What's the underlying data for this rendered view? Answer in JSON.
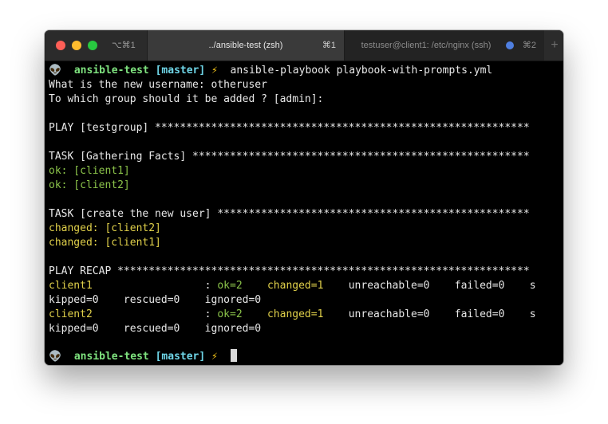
{
  "window": {
    "shortcut_left": "⌥⌘1",
    "tabs": [
      {
        "title": "../ansible-test (zsh)",
        "shortcut": "⌘1"
      },
      {
        "title": "testuser@client1: /etc/nginx (ssh)",
        "shortcut": "⌘2"
      }
    ],
    "new_tab_symbol": "+"
  },
  "terminal": {
    "prompt_icon": "👽",
    "prompt_dir": "ansible-test",
    "prompt_branch": "[master]",
    "prompt_bolt": "⚡",
    "command": "ansible-playbook playbook-with-prompts.yml",
    "q1_label": "What is the new username:",
    "q1_answer": "otheruser",
    "q2_label": "To which group should it be added ? [admin]:",
    "play_header": "PLAY [testgroup] ************************************************************",
    "task1_header": "TASK [Gathering Facts] ******************************************************",
    "task1_results": [
      "ok: [client1]",
      "ok: [client2]"
    ],
    "task2_header": "TASK [create the new user] **************************************************",
    "task2_results": [
      "changed: [client2]",
      "changed: [client1]"
    ],
    "recap_header": "PLAY RECAP ******************************************************************",
    "recap": [
      {
        "host": "client1",
        "sep": "                  : ",
        "ok": "ok=2",
        "gap1": "    ",
        "changed": "changed=1",
        "rest": "    unreachable=0    failed=0    s",
        "line2": "kipped=0    rescued=0    ignored=0"
      },
      {
        "host": "client2",
        "sep": "                  : ",
        "ok": "ok=2",
        "gap1": "    ",
        "changed": "changed=1",
        "rest": "    unreachable=0    failed=0    s",
        "line2": "kipped=0    rescued=0    ignored=0"
      }
    ]
  }
}
